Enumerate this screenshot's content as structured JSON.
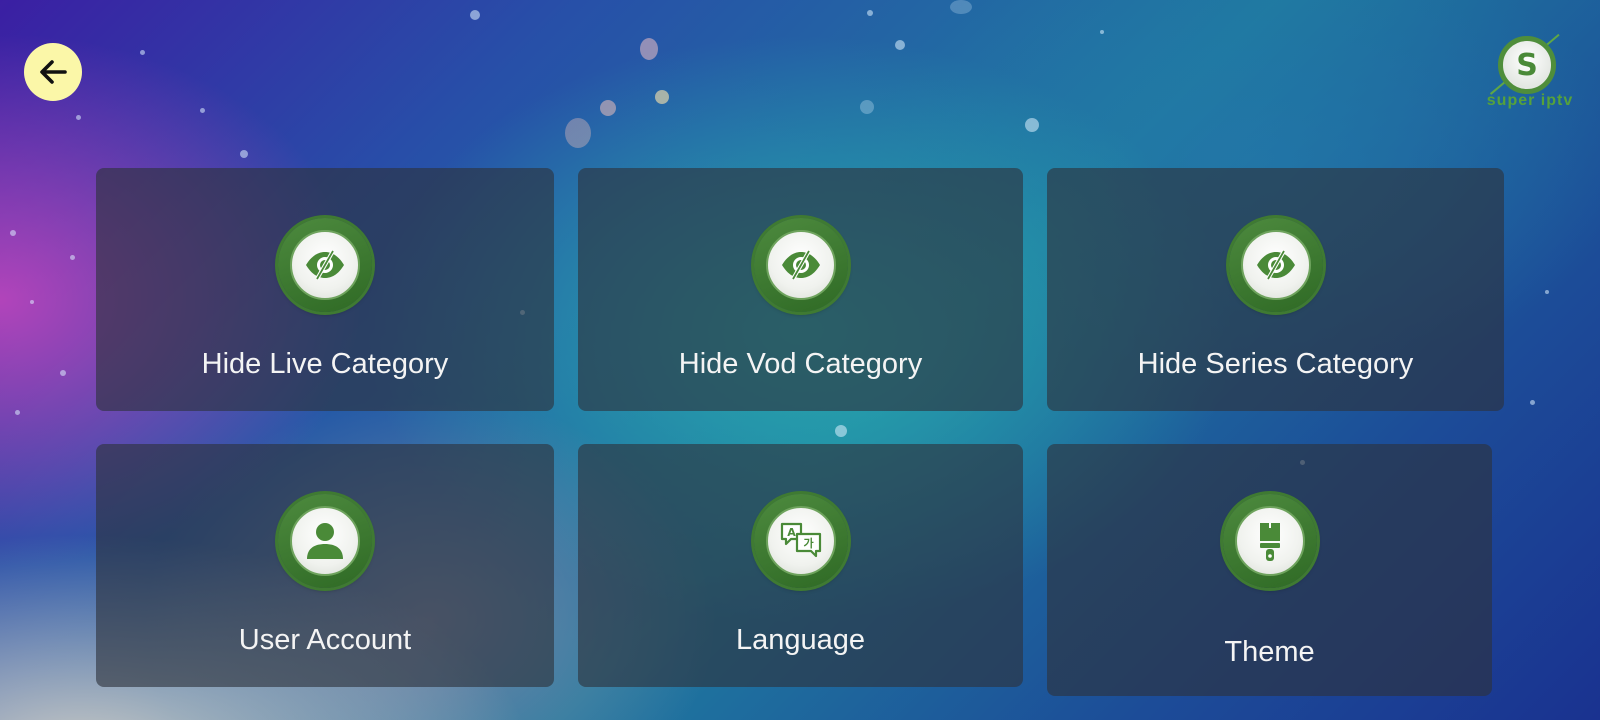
{
  "header": {
    "back_icon": "arrow-left-icon",
    "logo_letter": "S",
    "logo_text": "super iptv"
  },
  "cards": [
    {
      "label": "Hide Live Category",
      "icon": "eye-slash-icon"
    },
    {
      "label": "Hide Vod Category",
      "icon": "eye-slash-icon"
    },
    {
      "label": "Hide Series Category",
      "icon": "eye-slash-icon"
    },
    {
      "label": "User Account",
      "icon": "user-icon"
    },
    {
      "label": "Language",
      "icon": "translate-icon"
    },
    {
      "label": "Theme",
      "icon": "paint-brush-icon"
    }
  ],
  "colors": {
    "back_button": "#fbf7a8",
    "icon_green": "#4d8a3e",
    "card_background": "rgba(45,50,60,0.62)"
  }
}
